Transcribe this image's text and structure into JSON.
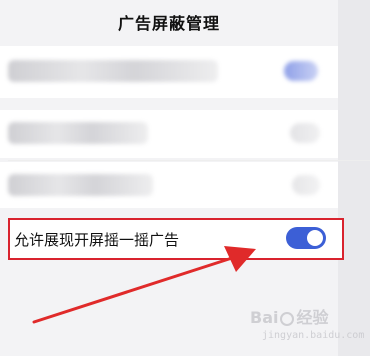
{
  "header": {
    "title": "广告屏蔽管理"
  },
  "settings": {
    "highlighted_item": {
      "label": "允许展现开屏摇一摇广告",
      "enabled": true
    }
  },
  "colors": {
    "toggle_on": "#3c5fd6",
    "highlight_border": "#d9232e",
    "arrow": "#e02a2a"
  },
  "watermark": {
    "brand_left": "Bai",
    "brand_right": "经验",
    "url": "jingyan.baidu.com"
  }
}
